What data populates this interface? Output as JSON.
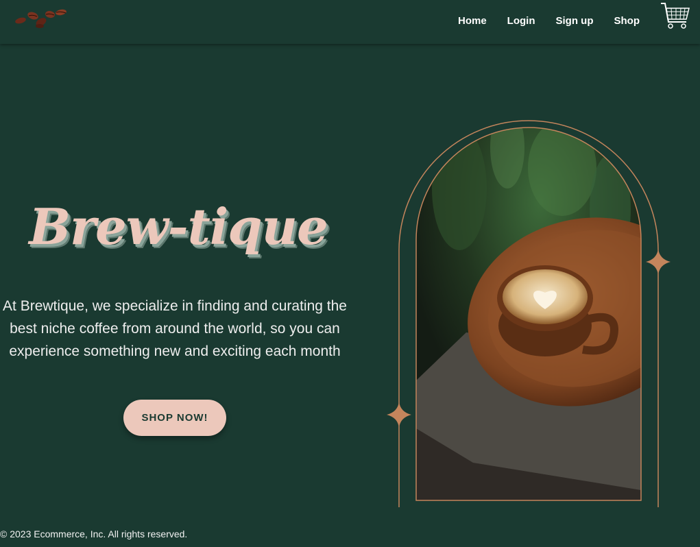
{
  "nav": {
    "logo_icon": "coffee-beans-icon",
    "links": [
      {
        "label": "Home"
      },
      {
        "label": "Login"
      },
      {
        "label": "Sign up"
      },
      {
        "label": "Shop"
      }
    ],
    "cart_icon": "shopping-cart-icon"
  },
  "hero": {
    "title": "Brew-tique",
    "description": "At Brewtique, we specialize in finding and curating the best niche coffee from around the world, so you can experience something new and exciting each month",
    "cta_label": "SHOP NOW!",
    "image_subject": "latte cup on wooden plate",
    "sparkle_icon": "sparkle-icon"
  },
  "footer": {
    "copyright": "© 2023 Ecommerce, Inc. All rights reserved."
  },
  "colors": {
    "background": "#1a3a31",
    "accent": "#ecc8bb",
    "frame": "#c4855c",
    "text_light": "#eeeeee"
  }
}
